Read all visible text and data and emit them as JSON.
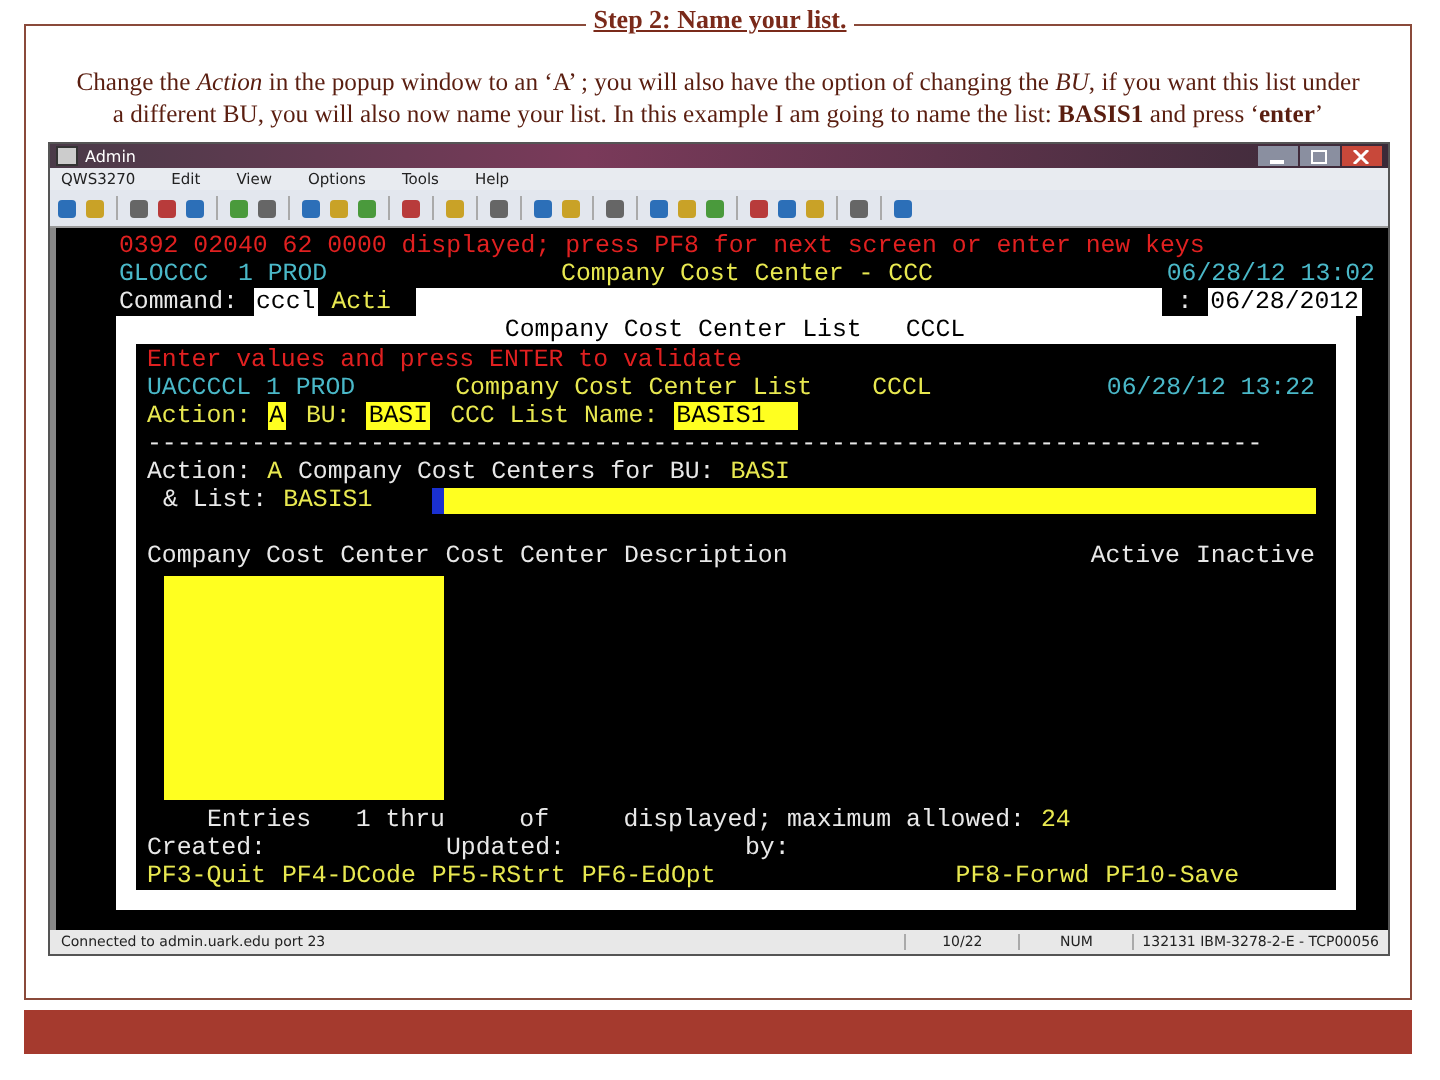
{
  "slide": {
    "title": "Step 2:  Name your list.",
    "instructions": "Change the *Action* in the popup window to an ‘A’ ; you will also have the option of changing the *BU*, if you want this list under a different BU, you will also now name your list.  In this example I am going to name the list: **BASIS1** and press ‘**enter**’"
  },
  "window": {
    "title": "Admin",
    "menu": [
      "QWS3270",
      "Edit",
      "View",
      "Options",
      "Tools",
      "Help"
    ]
  },
  "screen": {
    "message": "0392 02040 62 0000 displayed; press PF8 for next screen or enter new keys",
    "program": "GLOCCC  1 PROD",
    "heading": "Company Cost Center - CCC",
    "timestamp": "06/28/12 13:02",
    "command_label": "Command:",
    "command_value": "cccl",
    "command_overflow": "Acti",
    "date_label": ":",
    "date_value": "06/28/2012"
  },
  "popup": {
    "title": "Company Cost Center List",
    "code": "CCCL",
    "message": "Enter values and press ENTER to validate",
    "program": "UACCCCL 1 PROD",
    "heading": "Company Cost Center List",
    "heading_code": "CCCL",
    "timestamp": "06/28/12 13:22",
    "fields": [
      {
        "label": "Action:",
        "value": "A"
      },
      {
        "label": "BU:",
        "value": "BASI"
      },
      {
        "label": "CCC List Name:",
        "value": "BASIS1"
      }
    ],
    "separator": "---------------------------------------------------------------------------",
    "summary_label": "Action:",
    "summary_action": "A",
    "summary_text": "Company Cost Centers for BU:",
    "summary_bu": "BASI",
    "list_label": "& List:",
    "list_value": "BASIS1",
    "columns_left": [
      "Company Cost Center",
      "Cost Center Description"
    ],
    "columns_right": [
      "Active",
      "Inactive"
    ],
    "entries": "Entries   1 thru     of     displayed; maximum allowed:",
    "max_allowed": "24",
    "audit": [
      "Created:",
      "Updated:",
      "by:"
    ],
    "keys": [
      "PF3-Quit",
      "PF4-DCode",
      "PF5-RStrt",
      "PF6-EdOpt",
      "PF8-Forwd",
      "PF10-Save"
    ]
  },
  "status_bar": [
    "Connected to admin.uark.edu port 23",
    "10/22",
    "NUM",
    "132131  IBM-3278-2-E - TCP00056"
  ]
}
